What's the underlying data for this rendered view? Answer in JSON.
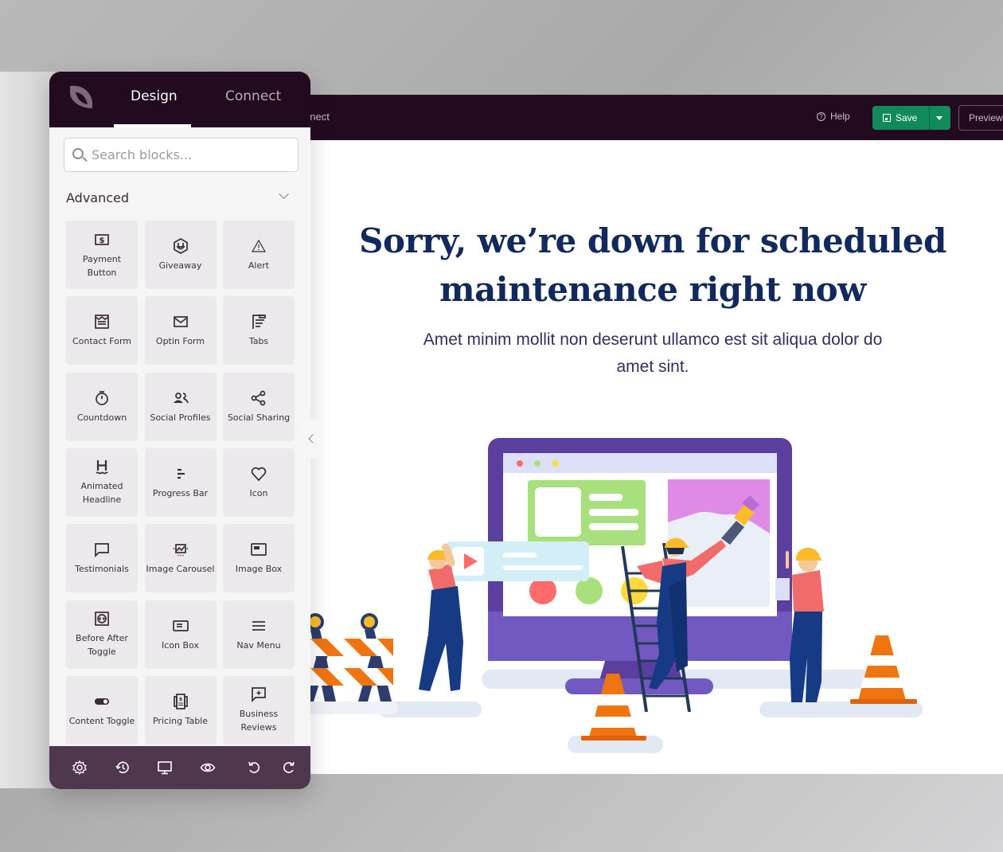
{
  "sidebar": {
    "tabs": [
      {
        "label": "Design",
        "active": true
      },
      {
        "label": "Connect",
        "active": false
      }
    ],
    "search": {
      "placeholder": "Search blocks...",
      "value": ""
    },
    "section": {
      "title": "Advanced",
      "expanded": true
    },
    "blocks": [
      {
        "label": "Payment Button",
        "icon": "payment-button-icon"
      },
      {
        "label": "Giveaway",
        "icon": "giveaway-icon"
      },
      {
        "label": "Alert",
        "icon": "alert-icon"
      },
      {
        "label": "Contact Form",
        "icon": "contact-form-icon"
      },
      {
        "label": "Optin Form",
        "icon": "optin-form-icon"
      },
      {
        "label": "Tabs",
        "icon": "tabs-icon"
      },
      {
        "label": "Countdown",
        "icon": "countdown-icon"
      },
      {
        "label": "Social Profiles",
        "icon": "social-profiles-icon"
      },
      {
        "label": "Social Sharing",
        "icon": "social-sharing-icon"
      },
      {
        "label": "Animated Headline",
        "icon": "animated-headline-icon"
      },
      {
        "label": "Progress Bar",
        "icon": "progress-bar-icon"
      },
      {
        "label": "Icon",
        "icon": "heart-icon"
      },
      {
        "label": "Testimonials",
        "icon": "testimonials-icon"
      },
      {
        "label": "Image Carousel",
        "icon": "image-carousel-icon"
      },
      {
        "label": "Image Box",
        "icon": "image-box-icon"
      },
      {
        "label": "Before After Toggle",
        "icon": "before-after-toggle-icon"
      },
      {
        "label": "Icon Box",
        "icon": "icon-box-icon"
      },
      {
        "label": "Nav Menu",
        "icon": "nav-menu-icon"
      },
      {
        "label": "Content Toggle",
        "icon": "content-toggle-icon"
      },
      {
        "label": "Pricing Table",
        "icon": "pricing-table-icon"
      },
      {
        "label": "Business Reviews",
        "icon": "business-reviews-icon"
      }
    ],
    "footer_icons": [
      "gear-icon",
      "history-icon",
      "desktop-icon",
      "eye-icon",
      "undo-icon",
      "redo-icon"
    ]
  },
  "topbar": {
    "connect_fragment": "nnect",
    "help_label": "Help",
    "save_label": "Save",
    "preview_label": "Preview"
  },
  "page": {
    "headline": "Sorry, we’re down for scheduled maintenance right now",
    "subtext": "Amet minim mollit non deserunt ullamco est sit aliqua dolor do amet sint."
  },
  "colors": {
    "topbar": "#230b1f",
    "footer": "#4f384d",
    "save": "#128b5a",
    "headline": "#12295e",
    "monitor": "#5a3f9e"
  }
}
